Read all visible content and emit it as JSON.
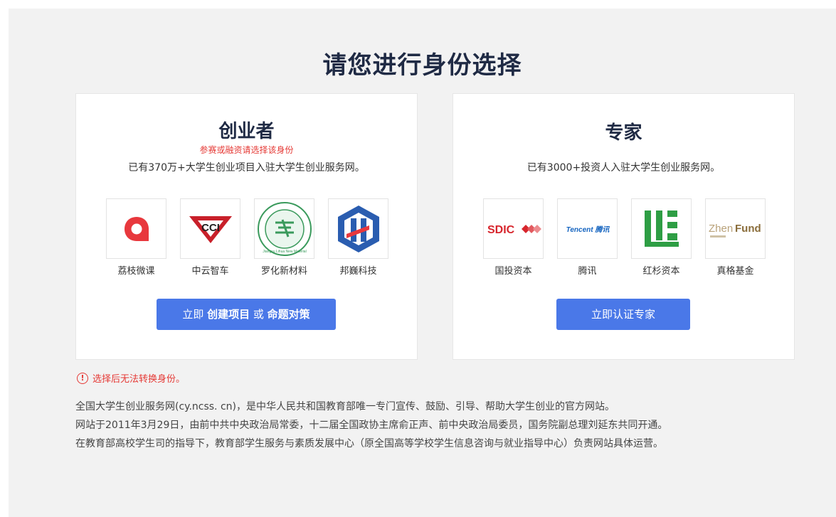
{
  "page_title": "请您进行身份选择",
  "entrepreneur": {
    "title": "创业者",
    "note": "参赛或融资请选择该身份",
    "description": "已有370万+大学生创业项目入驻大学生创业服务网。",
    "logos": [
      {
        "label": "荔枝微课",
        "icon": "lizhi-logo"
      },
      {
        "label": "中云智车",
        "icon": "zhongyun-cci-logo",
        "logo_text": "CCI"
      },
      {
        "label": "罗化新材料",
        "icon": "luohua-logo",
        "logo_text": "Jiangsu Lihua New Material"
      },
      {
        "label": "邦巍科技",
        "icon": "bangwei-logo"
      }
    ],
    "button": {
      "prefix": "立即 ",
      "part1": "创建项目",
      "middle": " 或 ",
      "part2": "命题对策"
    }
  },
  "expert": {
    "title": "专家",
    "description": "已有3000+投资人入驻大学生创业服务网。",
    "logos": [
      {
        "label": "国投资本",
        "icon": "sdic-logo",
        "logo_text": "SDIC"
      },
      {
        "label": "腾讯",
        "icon": "tencent-logo",
        "logo_text": "Tencent 腾讯"
      },
      {
        "label": "红杉资本",
        "icon": "sequoia-logo"
      },
      {
        "label": "真格基金",
        "icon": "zhenfund-logo",
        "logo_text_a": "Zhen",
        "logo_text_b": "Fund"
      }
    ],
    "button": {
      "label": "立即认证专家"
    }
  },
  "warning": {
    "icon": "exclamation-circle-icon",
    "symbol": "!",
    "text": "选择后无法转换身份。"
  },
  "info_lines": [
    "全国大学生创业服务网(cy.ncss. cn)，是中华人民共和国教育部唯一专门宣传、鼓励、引导、帮助大学生创业的官方网站。",
    "网站于2011年3月29日，由前中共中央政治局常委，十二届全国政协主席俞正声、前中央政治局委员，国务院副总理刘延东共同开通。",
    "在教育部高校学生司的指导下，教育部学生服务与素质发展中心（原全国高等学校学生信息咨询与就业指导中心）负责网站具体运营。"
  ],
  "colors": {
    "accent": "#4a78e8",
    "title": "#1f2a44",
    "warning": "#e53935",
    "background": "#f2f2f2"
  }
}
